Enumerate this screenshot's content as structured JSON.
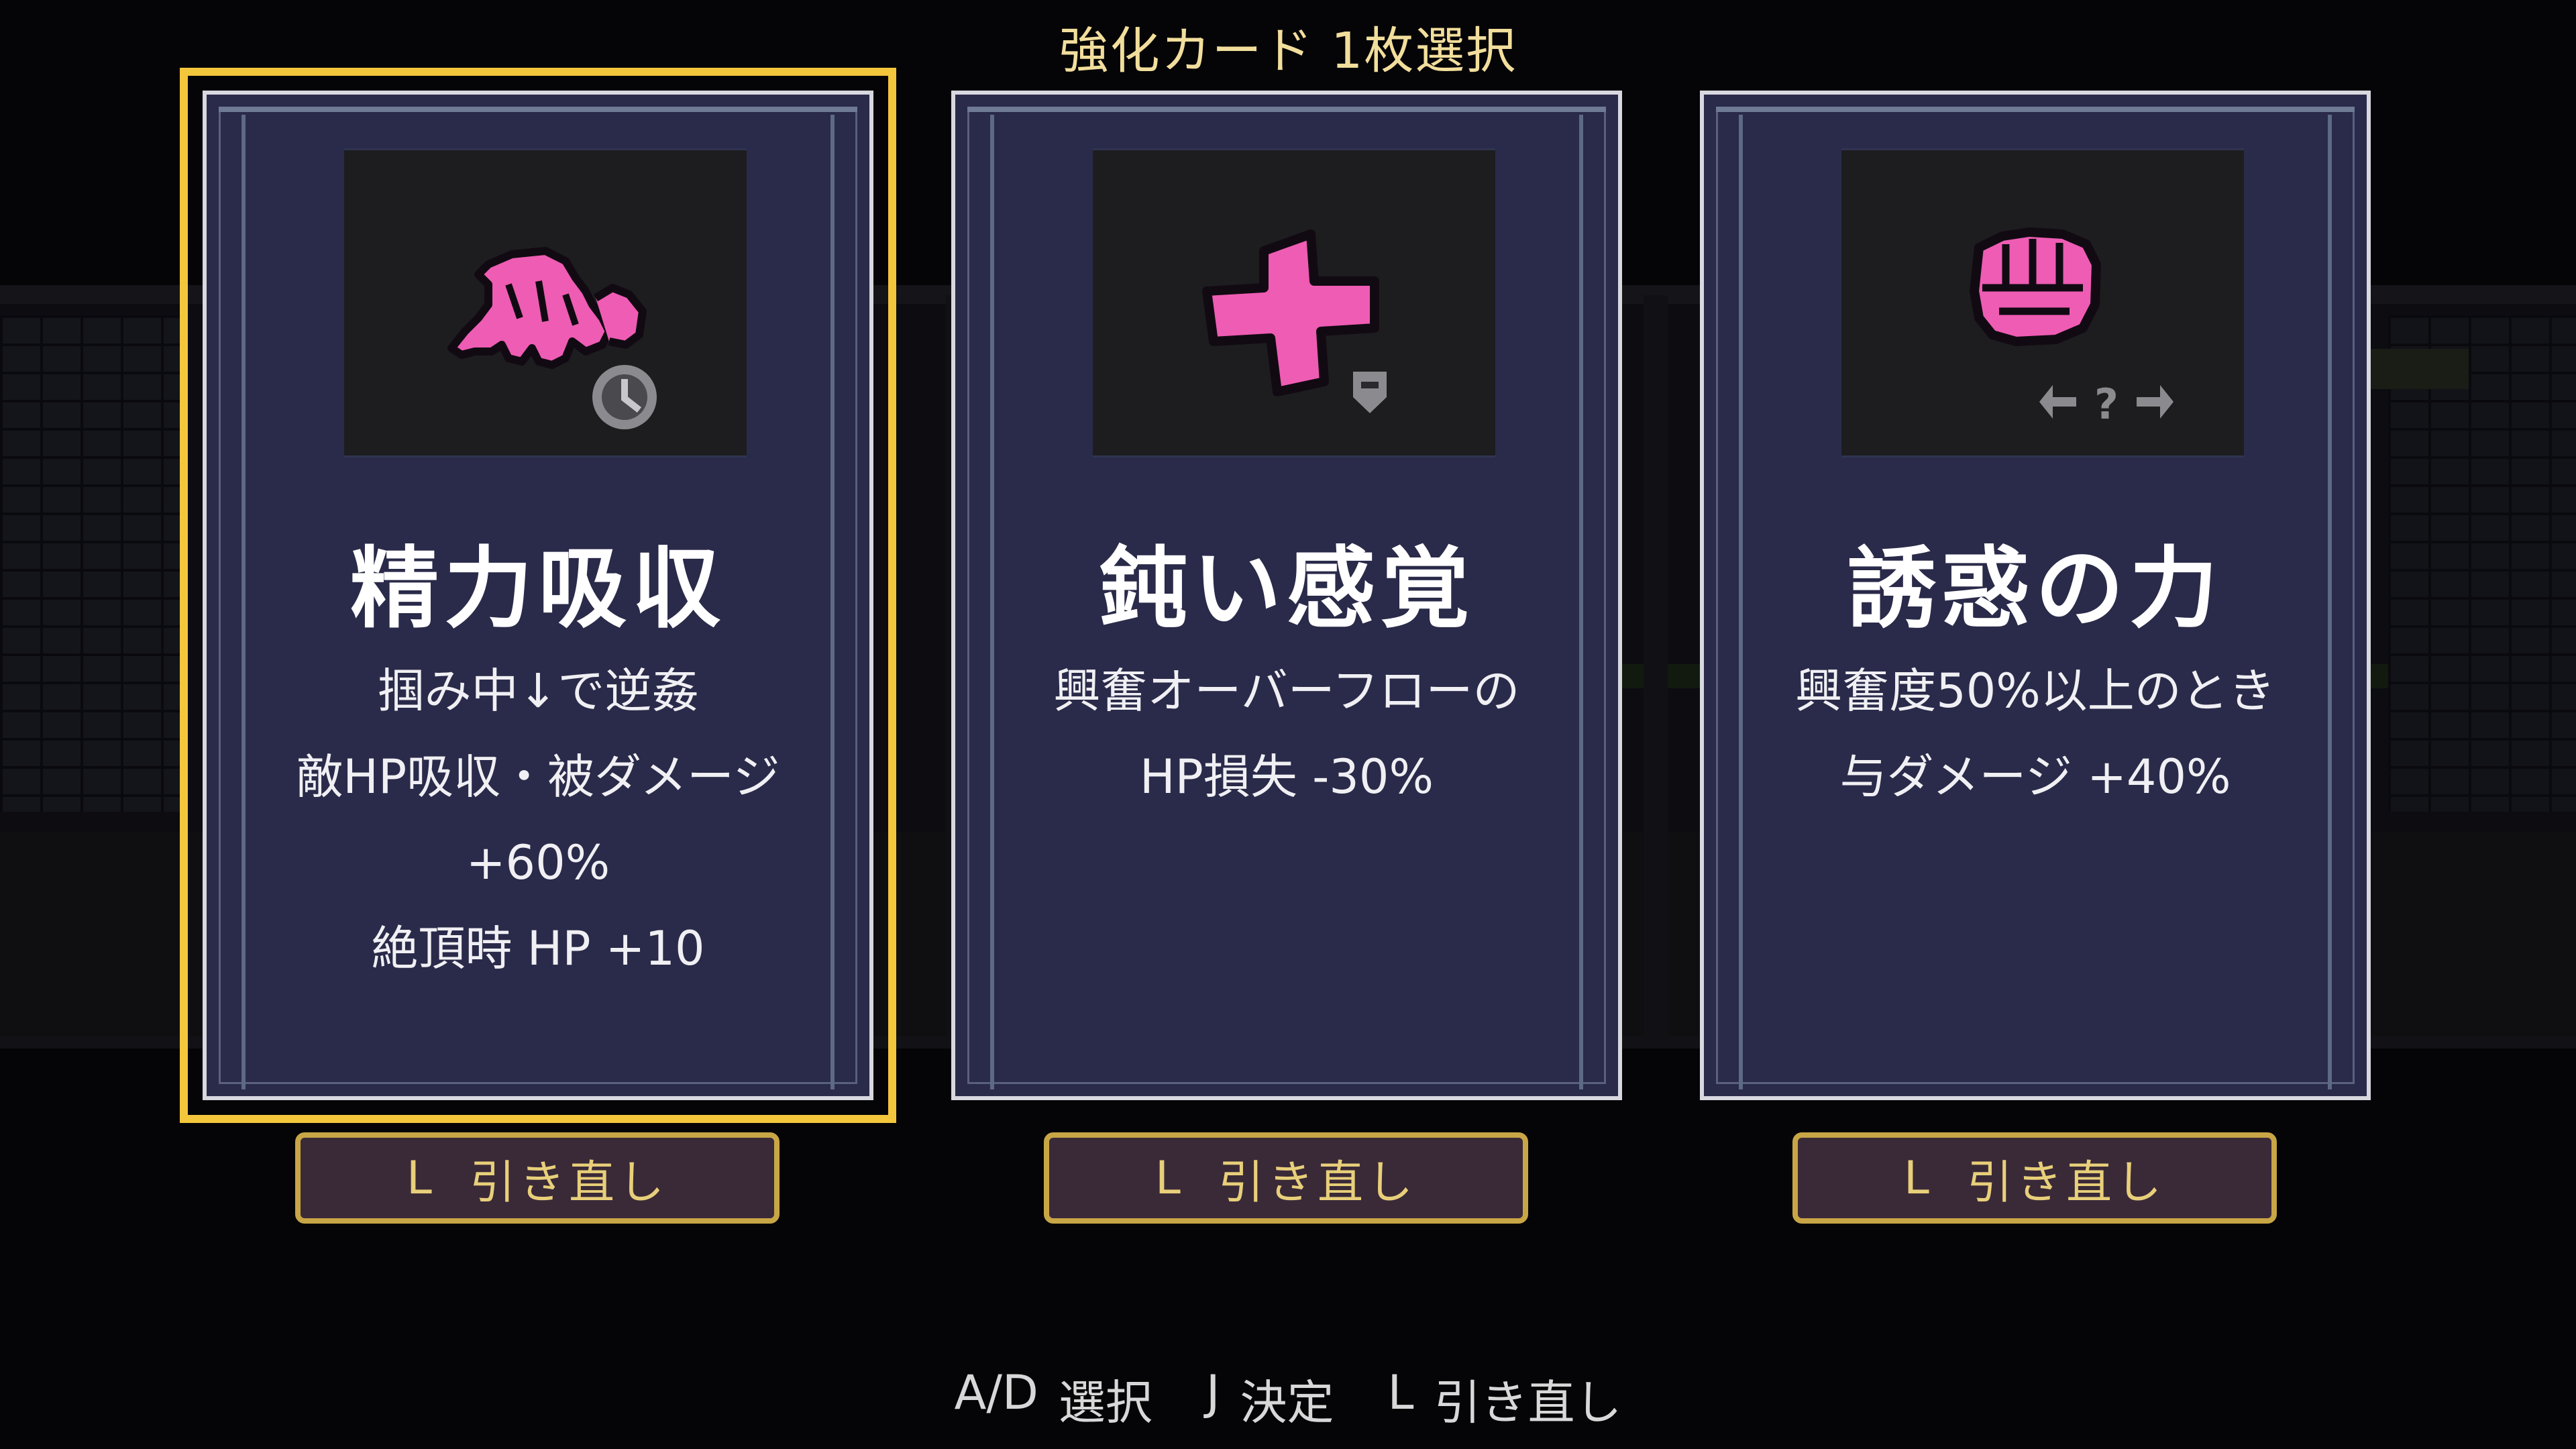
{
  "header": {
    "title": "強化カード 1枚選択"
  },
  "cards": [
    {
      "title": "精力吸収",
      "icon": "grab-hand-icon",
      "badge": "clock-icon",
      "desc": [
        "掴み中↓で逆姦",
        "敵HP吸収・被ダメージ",
        "+60%",
        "絶頂時 HP +10"
      ],
      "reroll_key": "L",
      "reroll_label": "引き直し",
      "selected": true
    },
    {
      "title": "鈍い感覚",
      "icon": "pink-cross-icon",
      "badge": "shield-minus-icon",
      "desc": [
        "興奮オーバーフローの",
        "HP損失 -30%"
      ],
      "reroll_key": "L",
      "reroll_label": "引き直し",
      "selected": false
    },
    {
      "title": "誘惑の力",
      "icon": "fist-icon",
      "badge": "unknown-swap-icon",
      "desc": [
        "興奮度50%以上のとき",
        "与ダメージ +40%"
      ],
      "reroll_key": "L",
      "reroll_label": "引き直し",
      "selected": false
    }
  ],
  "footer": {
    "select_keys": "A/D",
    "select_label": "選択",
    "confirm_key": "J",
    "confirm_label": "決定",
    "reroll_key": "L",
    "reroll_label": "引き直し"
  },
  "colors": {
    "card_bg": "#2a2a4a",
    "selected_border": "#f3c63c",
    "icon_pink": "#ee5cb4",
    "reroll_border": "#c8a646"
  }
}
